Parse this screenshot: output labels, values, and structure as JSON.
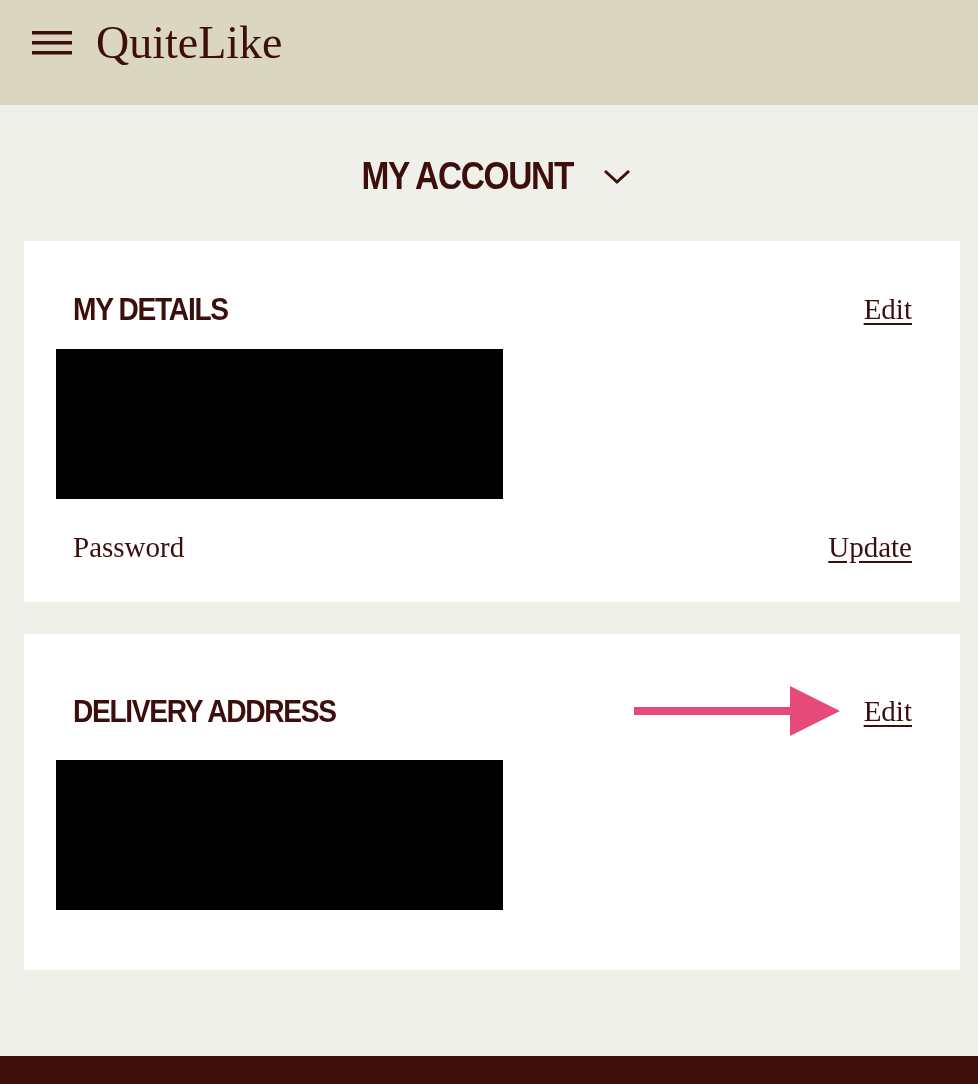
{
  "header": {
    "logo": "QuiteLike"
  },
  "page_title": {
    "label": "MY ACCOUNT",
    "expanded": false
  },
  "sections": [
    {
      "title": "MY DETAILS",
      "action": "Edit",
      "action_marked": false,
      "redacted": true,
      "rows": [
        {
          "label": "Password",
          "action": "Update"
        }
      ]
    },
    {
      "title": "DELIVERY ADDRESS",
      "action": "Edit",
      "action_marked": true,
      "redacted": true
    }
  ]
}
